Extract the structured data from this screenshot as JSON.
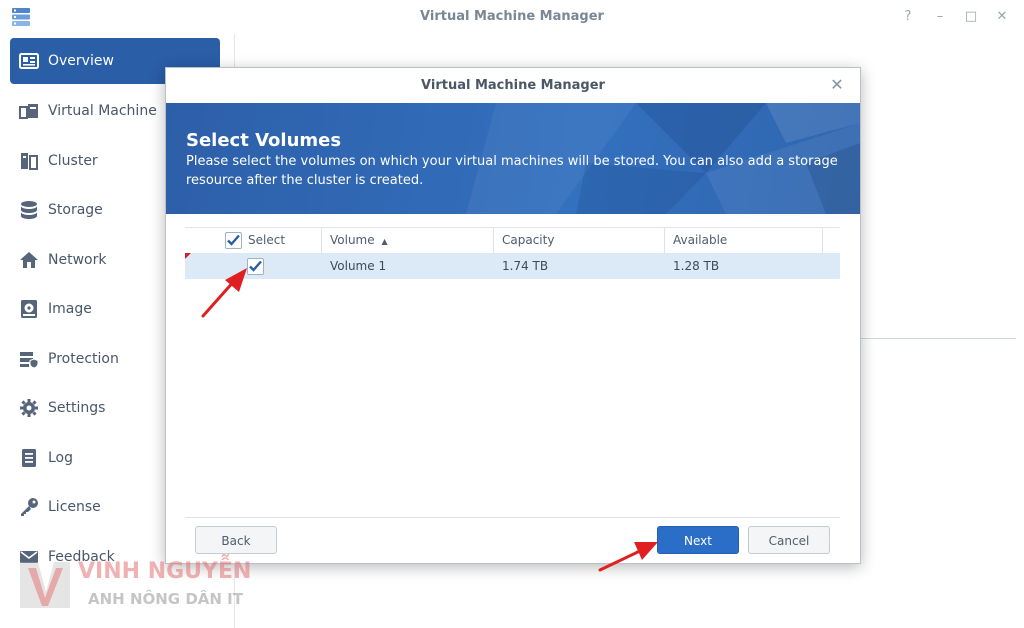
{
  "app": {
    "title": "Virtual Machine Manager",
    "controls": [
      "?",
      "–",
      "□",
      "✕"
    ]
  },
  "sidebar": {
    "items": [
      {
        "label": "Overview",
        "icon": "overview-icon",
        "active": true
      },
      {
        "label": "Virtual Machine",
        "icon": "virtual-machine-icon"
      },
      {
        "label": "Cluster",
        "icon": "cluster-icon"
      },
      {
        "label": "Storage",
        "icon": "storage-icon"
      },
      {
        "label": "Network",
        "icon": "network-icon"
      },
      {
        "label": "Image",
        "icon": "image-icon"
      },
      {
        "label": "Protection",
        "icon": "protection-icon"
      },
      {
        "label": "Settings",
        "icon": "settings-icon"
      },
      {
        "label": "Log",
        "icon": "log-icon"
      },
      {
        "label": "License",
        "icon": "license-icon"
      },
      {
        "label": "Feedback",
        "icon": "feedback-icon"
      }
    ]
  },
  "dialog": {
    "title": "Virtual Machine Manager",
    "close": "✕",
    "banner_title": "Select Volumes",
    "banner_desc": "Please select the volumes on which your virtual machines will be stored. You can also add a storage resource after the cluster is created.",
    "columns": {
      "select": "Select",
      "volume": "Volume",
      "volume_sort": "▲",
      "capacity": "Capacity",
      "available": "Available"
    },
    "rows": [
      {
        "volume": "Volume 1",
        "capacity": "1.74 TB",
        "available": "1.28 TB",
        "selected": true
      }
    ],
    "buttons": {
      "back": "Back",
      "next": "Next",
      "cancel": "Cancel"
    }
  },
  "watermark": {
    "line1": "VINH NGUYỄN",
    "line2": "ANH NÔNG DÂN IT"
  },
  "colors": {
    "accent": "#2a5ea7",
    "banner": "#3370bf",
    "row_selected": "#dce9f7",
    "annotation": "#e02020"
  }
}
